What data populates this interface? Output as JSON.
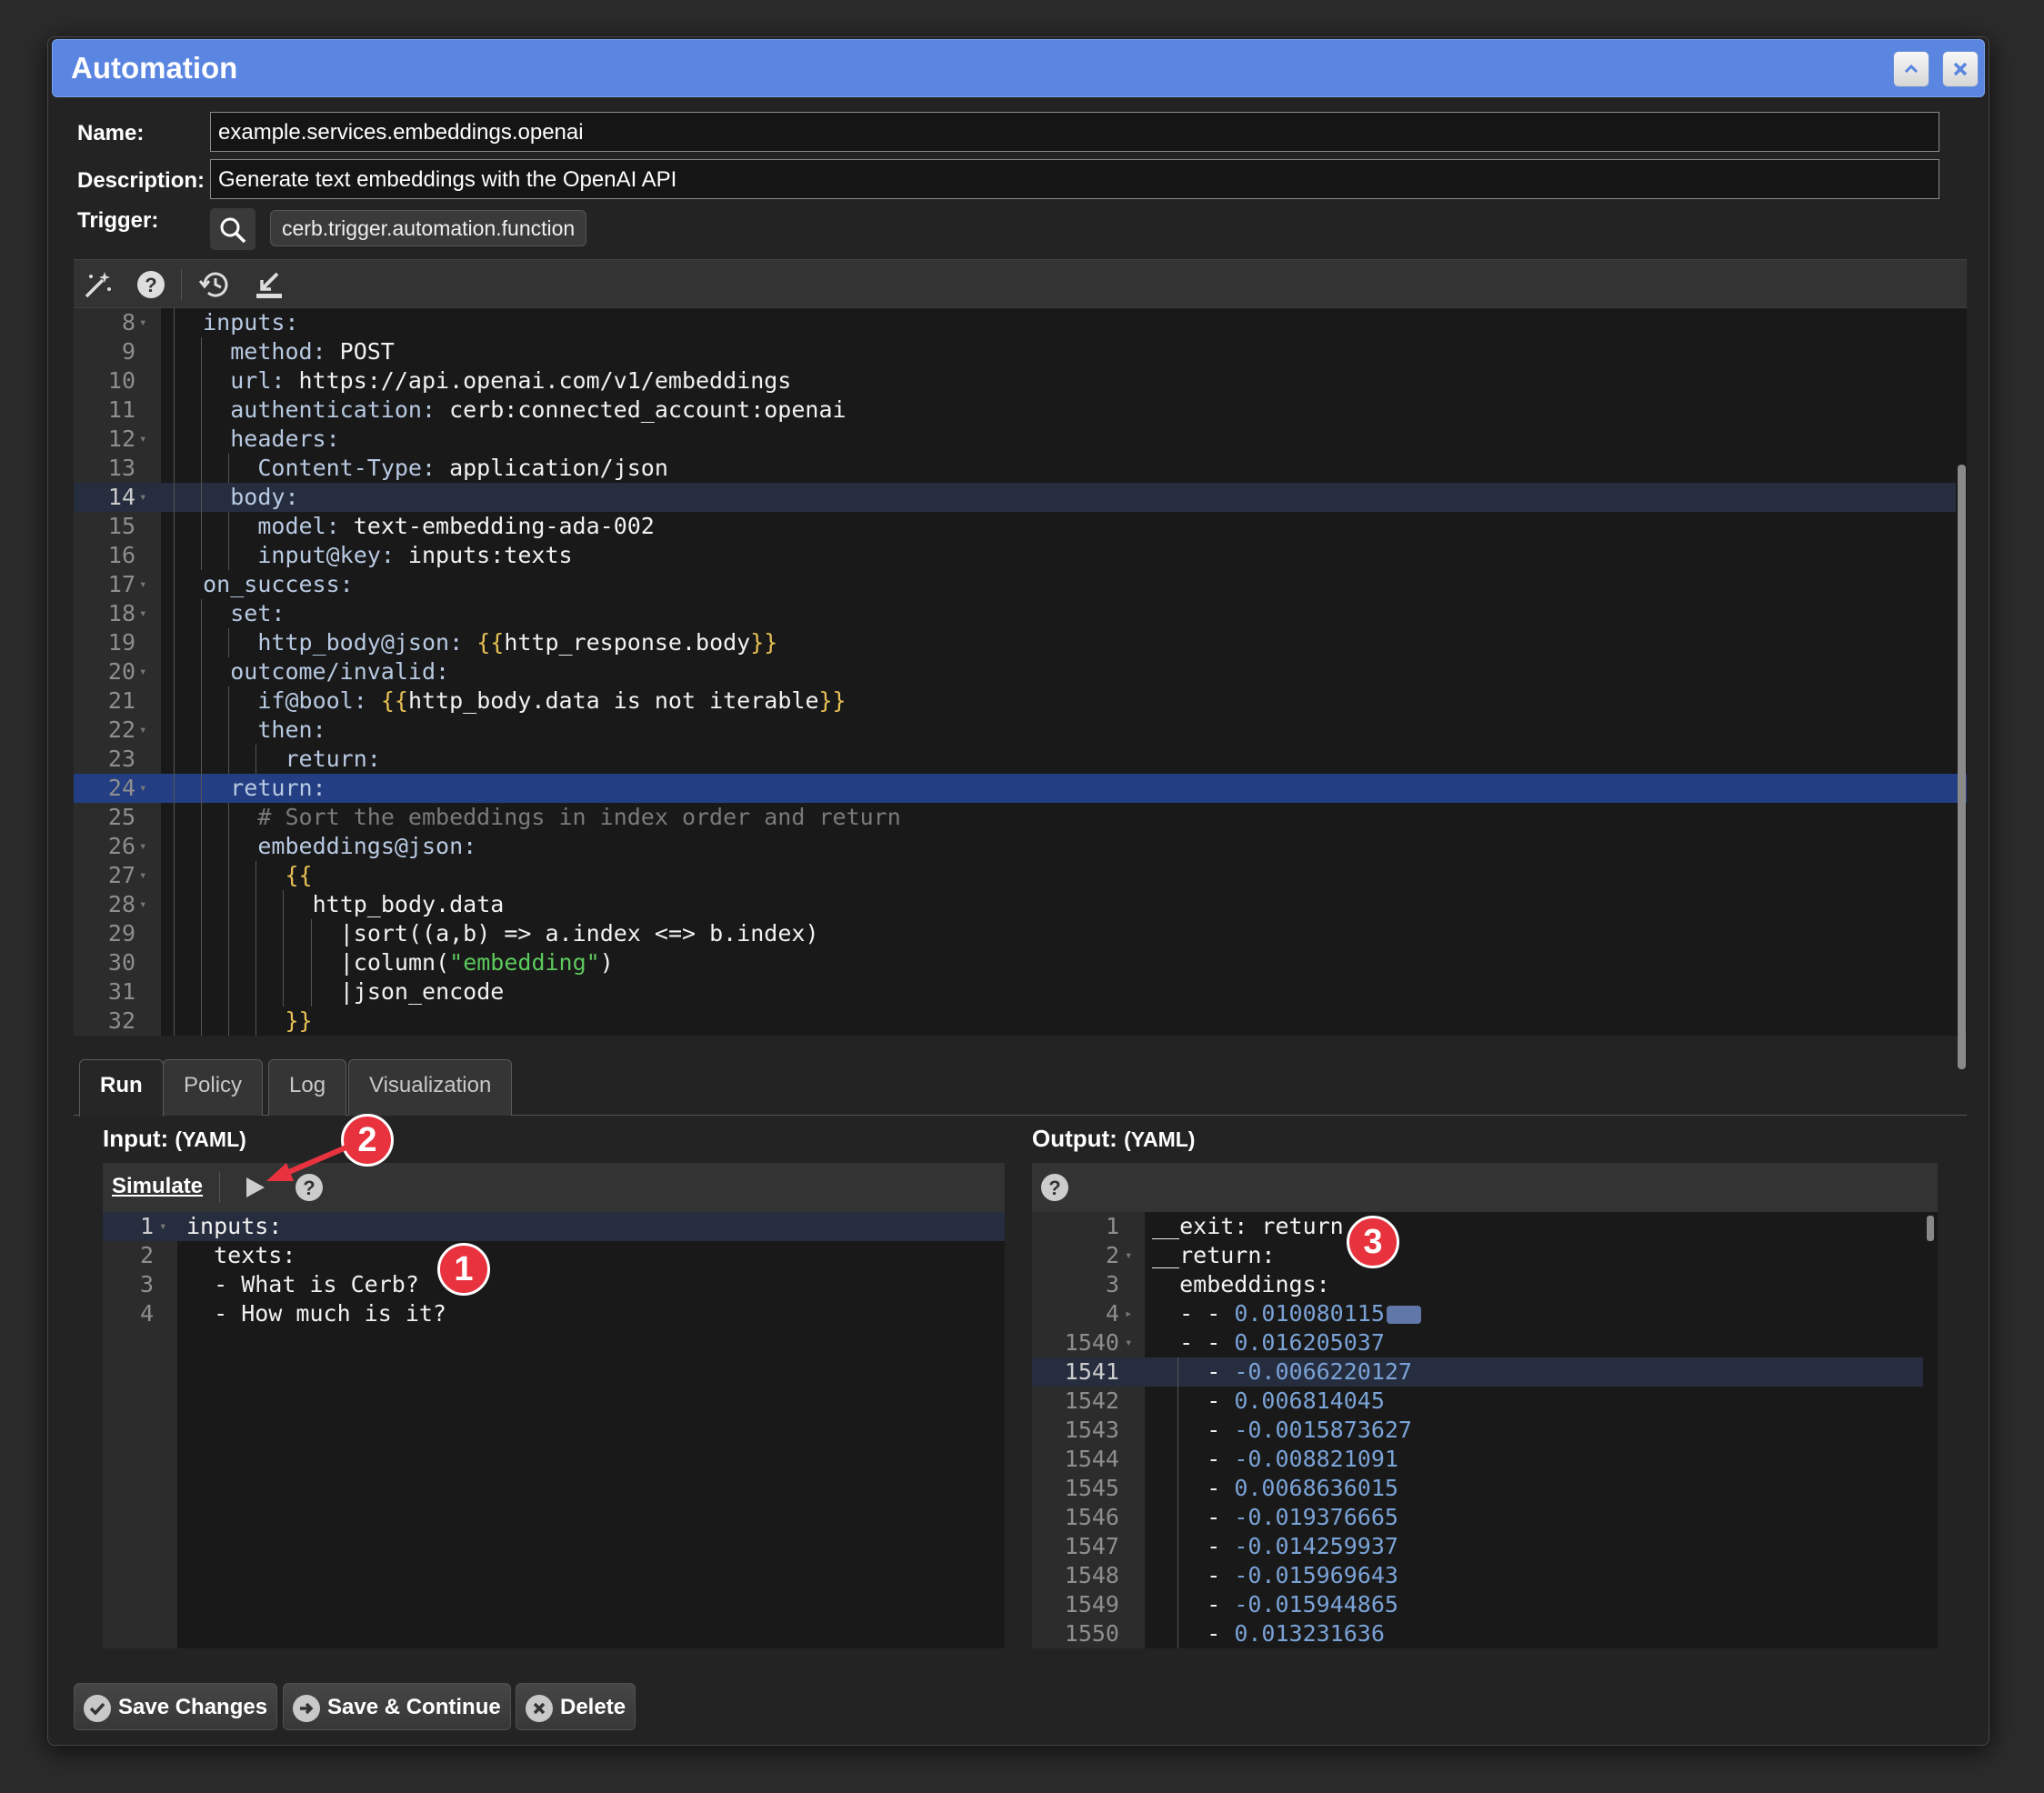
{
  "window": {
    "title": "Automation"
  },
  "form": {
    "name_label": "Name:",
    "name_value": "example.services.embeddings.openai",
    "description_label": "Description:",
    "description_value": "Generate text embeddings with the OpenAI API",
    "trigger_label": "Trigger:",
    "trigger_value": "cerb.trigger.automation.function"
  },
  "toolbar_icons": [
    "magic-wand-icon",
    "help-icon",
    "history-icon",
    "export-icon"
  ],
  "script_lines": [
    {
      "n": "8",
      "fold": true,
      "indent": 1,
      "key": "inputs:",
      "val": ""
    },
    {
      "n": "9",
      "fold": false,
      "indent": 2,
      "key": "method:",
      "val": " POST"
    },
    {
      "n": "10",
      "fold": false,
      "indent": 2,
      "key": "url:",
      "val": " https://api.openai.com/v1/embeddings"
    },
    {
      "n": "11",
      "fold": false,
      "indent": 2,
      "key": "authentication:",
      "val": " cerb:connected_account:openai"
    },
    {
      "n": "12",
      "fold": true,
      "indent": 2,
      "key": "headers:",
      "val": ""
    },
    {
      "n": "13",
      "fold": false,
      "indent": 3,
      "key": "Content-Type:",
      "val": " application/json"
    },
    {
      "n": "14",
      "fold": true,
      "indent": 2,
      "key": "body:",
      "val": "",
      "hl": "soft"
    },
    {
      "n": "15",
      "fold": false,
      "indent": 3,
      "key": "model:",
      "val": " text-embedding-ada-002"
    },
    {
      "n": "16",
      "fold": false,
      "indent": 3,
      "key": "input@key:",
      "val": " inputs:texts"
    },
    {
      "n": "17",
      "fold": true,
      "indent": 1,
      "key": "on_success:",
      "val": ""
    },
    {
      "n": "18",
      "fold": true,
      "indent": 2,
      "key": "set:",
      "val": ""
    },
    {
      "n": "19",
      "fold": false,
      "indent": 3,
      "key": "http_body@json:",
      "val": " ",
      "tmpl": "{{http_response.body}}"
    },
    {
      "n": "20",
      "fold": true,
      "indent": 2,
      "key": "outcome/invalid:",
      "val": ""
    },
    {
      "n": "21",
      "fold": false,
      "indent": 3,
      "key": "if@bool:",
      "val": " ",
      "tmpl": "{{http_body.data is not iterable}}"
    },
    {
      "n": "22",
      "fold": true,
      "indent": 3,
      "key": "then:",
      "val": ""
    },
    {
      "n": "23",
      "fold": false,
      "indent": 4,
      "key": "return:",
      "val": ""
    },
    {
      "n": "24",
      "fold": true,
      "indent": 2,
      "key": "return:",
      "val": "",
      "hl": "strong"
    },
    {
      "n": "25",
      "fold": false,
      "indent": 3,
      "comment": "# Sort the embeddings in index order and return"
    },
    {
      "n": "26",
      "fold": true,
      "indent": 3,
      "key": "embeddings@json:",
      "val": ""
    },
    {
      "n": "27",
      "fold": true,
      "indent": 4,
      "brace": "{{"
    },
    {
      "n": "28",
      "fold": true,
      "indent": 5,
      "key": "",
      "val": "http_body.data"
    },
    {
      "n": "29",
      "fold": false,
      "indent": 6,
      "key": "",
      "val": "|sort((a,b) => a.index <=> b.index)"
    },
    {
      "n": "30",
      "fold": false,
      "indent": 6,
      "key": "",
      "val": "|column(",
      "str": "\"embedding\"",
      "after": ")"
    },
    {
      "n": "31",
      "fold": false,
      "indent": 6,
      "key": "",
      "val": "|json_encode"
    },
    {
      "n": "32",
      "fold": false,
      "indent": 4,
      "brace": "}}"
    }
  ],
  "tabs": [
    "Run",
    "Policy",
    "Log",
    "Visualization"
  ],
  "active_tab": "Run",
  "input_panel": {
    "title": "Input:",
    "format": "(YAML)",
    "simulate_label": "Simulate",
    "lines": [
      {
        "n": "1",
        "fold": true,
        "text": "inputs:"
      },
      {
        "n": "2",
        "fold": false,
        "text": "  texts:"
      },
      {
        "n": "3",
        "fold": false,
        "text": "  - What is Cerb?"
      },
      {
        "n": "4",
        "fold": false,
        "text": "  - How much is it?"
      }
    ]
  },
  "output_panel": {
    "title": "Output:",
    "format": "(YAML)",
    "lines": [
      {
        "n": "1",
        "fold": "",
        "text": "__exit: return"
      },
      {
        "n": "2",
        "fold": "down",
        "text": "__return:"
      },
      {
        "n": "3",
        "fold": "",
        "text": "  embeddings:"
      },
      {
        "n": "4",
        "fold": "right",
        "prefix": "  - - ",
        "num": "0.010080115",
        "trunc": true
      },
      {
        "n": "1540",
        "fold": "down",
        "prefix": "  - - ",
        "num": "0.016205037"
      },
      {
        "n": "1541",
        "fold": "",
        "prefix": "    - ",
        "num": "-0.0066220127",
        "hl": true
      },
      {
        "n": "1542",
        "fold": "",
        "prefix": "    - ",
        "num": "0.006814045"
      },
      {
        "n": "1543",
        "fold": "",
        "prefix": "    - ",
        "num": "-0.0015873627"
      },
      {
        "n": "1544",
        "fold": "",
        "prefix": "    - ",
        "num": "-0.008821091"
      },
      {
        "n": "1545",
        "fold": "",
        "prefix": "    - ",
        "num": "0.0068636015"
      },
      {
        "n": "1546",
        "fold": "",
        "prefix": "    - ",
        "num": "-0.019376665"
      },
      {
        "n": "1547",
        "fold": "",
        "prefix": "    - ",
        "num": "-0.014259937"
      },
      {
        "n": "1548",
        "fold": "",
        "prefix": "    - ",
        "num": "-0.015969643"
      },
      {
        "n": "1549",
        "fold": "",
        "prefix": "    - ",
        "num": "-0.015944865"
      },
      {
        "n": "1550",
        "fold": "",
        "prefix": "    - ",
        "num": "0.013231636"
      }
    ]
  },
  "annotations": [
    "1",
    "2",
    "3"
  ],
  "buttons": {
    "save": "Save Changes",
    "save_continue": "Save & Continue",
    "delete": "Delete"
  },
  "colors": {
    "titlebar": "#5a85e0",
    "line_highlight": "#233e82",
    "badge": "#e8333f",
    "number": "#7aa2d6",
    "template_brace": "#e6c055",
    "string": "#5cc95c"
  }
}
